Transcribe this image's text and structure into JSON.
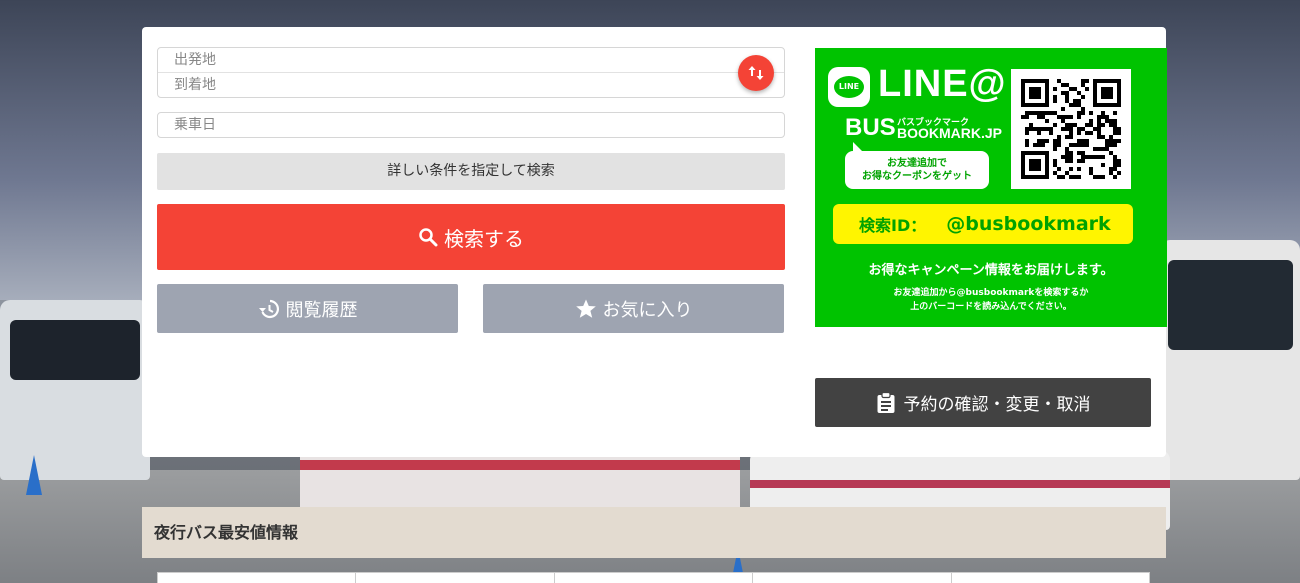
{
  "search": {
    "departure_placeholder": "出発地",
    "arrival_placeholder": "到着地",
    "date_placeholder": "乗車日",
    "advanced_label": "詳しい条件を指定して検索",
    "search_label": "検索する",
    "history_label": "閲覧履歴",
    "favorites_label": "お気に入り"
  },
  "line_promo": {
    "title": "LINE@",
    "logo_text": "LINE",
    "bus_wordmark": "BUS",
    "kana": "バスブックマーク",
    "brand": "BOOKMARK.JP",
    "bubble_line1": "お友達追加で",
    "bubble_line2": "お得なクーポンをゲット",
    "id_label": "検索ID：",
    "id_value": "@busbookmark",
    "message": "お得なキャンペーン情報をお届けします。",
    "note_line1": "お友達追加から@busbookmarkを検索するか",
    "note_line2": "上のバーコードを読み込んでください。"
  },
  "reservation": {
    "label": "予約の確認・変更・取消"
  },
  "section": {
    "title": "夜行バス最安値情報"
  },
  "colors": {
    "accent_red": "#f44336",
    "line_green": "#00c300",
    "id_yellow": "#fff500",
    "gray_button": "#9ea4b1",
    "dark_button": "#424242"
  },
  "icons": {
    "swap": "swap-vertical-icon",
    "search": "search-icon",
    "history": "history-icon",
    "favorite": "star-icon",
    "clipboard": "clipboard-icon"
  }
}
